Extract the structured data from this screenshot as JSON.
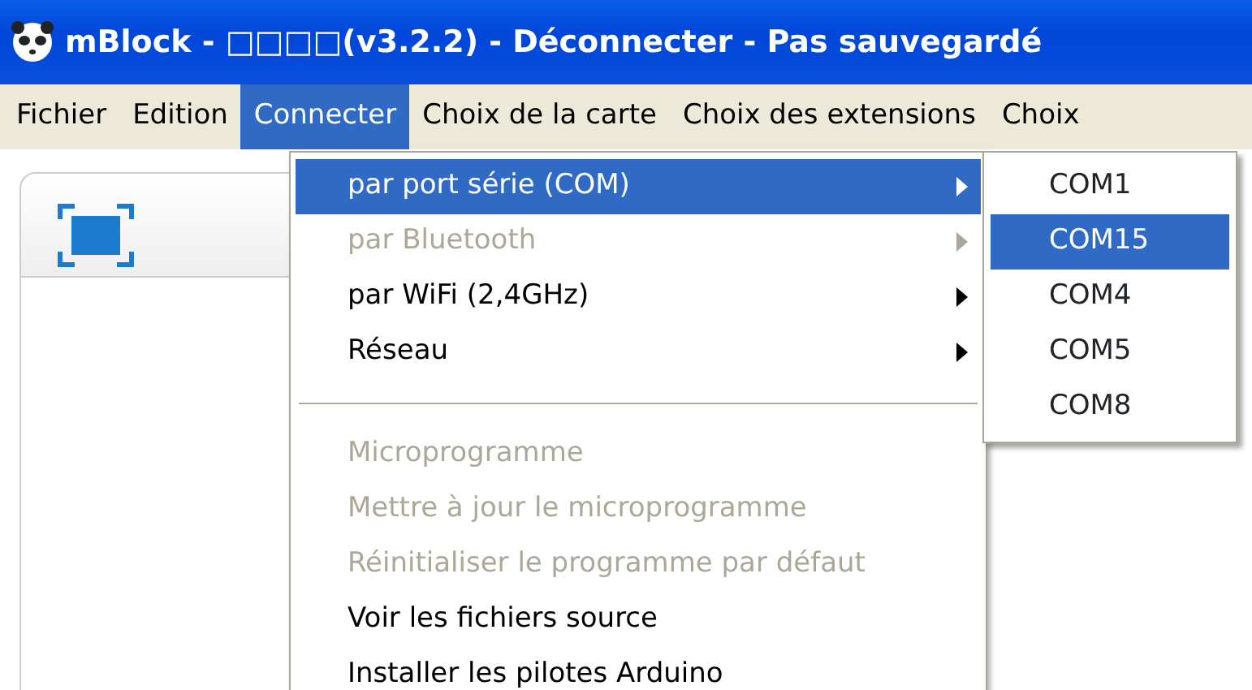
{
  "window": {
    "title": "mBlock - □□□□(v3.2.2) - Déconnecter - Pas sauvegardé"
  },
  "menu_bar": [
    {
      "label": "Fichier",
      "selected": false
    },
    {
      "label": "Edition",
      "selected": false
    },
    {
      "label": "Connecter",
      "selected": true
    },
    {
      "label": "Choix de la carte",
      "selected": false
    },
    {
      "label": "Choix des extensions",
      "selected": false
    },
    {
      "label": "Choix",
      "selected": false
    }
  ],
  "menu": [
    {
      "kind": "item",
      "label": "par port série (COM)",
      "selected": true,
      "disabled": false,
      "submenu": true
    },
    {
      "kind": "item",
      "label": "par Bluetooth",
      "selected": false,
      "disabled": true,
      "submenu": true
    },
    {
      "kind": "item",
      "label": "par WiFi (2,4GHz)",
      "selected": false,
      "disabled": false,
      "submenu": true
    },
    {
      "kind": "item",
      "label": "Réseau",
      "selected": false,
      "disabled": false,
      "submenu": true
    },
    {
      "kind": "separator"
    },
    {
      "kind": "item",
      "label": "Microprogramme",
      "selected": false,
      "disabled": true,
      "submenu": false
    },
    {
      "kind": "item",
      "label": "Mettre à jour le microprogramme",
      "selected": false,
      "disabled": true,
      "submenu": false
    },
    {
      "kind": "item",
      "label": "Réinitialiser le programme par défaut",
      "selected": false,
      "disabled": true,
      "submenu": false
    },
    {
      "kind": "item",
      "label": "Voir les fichiers source",
      "selected": false,
      "disabled": false,
      "submenu": false
    },
    {
      "kind": "item",
      "label": "Installer les pilotes Arduino",
      "selected": false,
      "disabled": false,
      "submenu": false
    }
  ],
  "submenu": [
    {
      "label": "COM1",
      "selected": false
    },
    {
      "label": "COM15",
      "selected": true
    },
    {
      "label": "COM4",
      "selected": false
    },
    {
      "label": "COM5",
      "selected": false
    },
    {
      "label": "COM8",
      "selected": false
    }
  ]
}
